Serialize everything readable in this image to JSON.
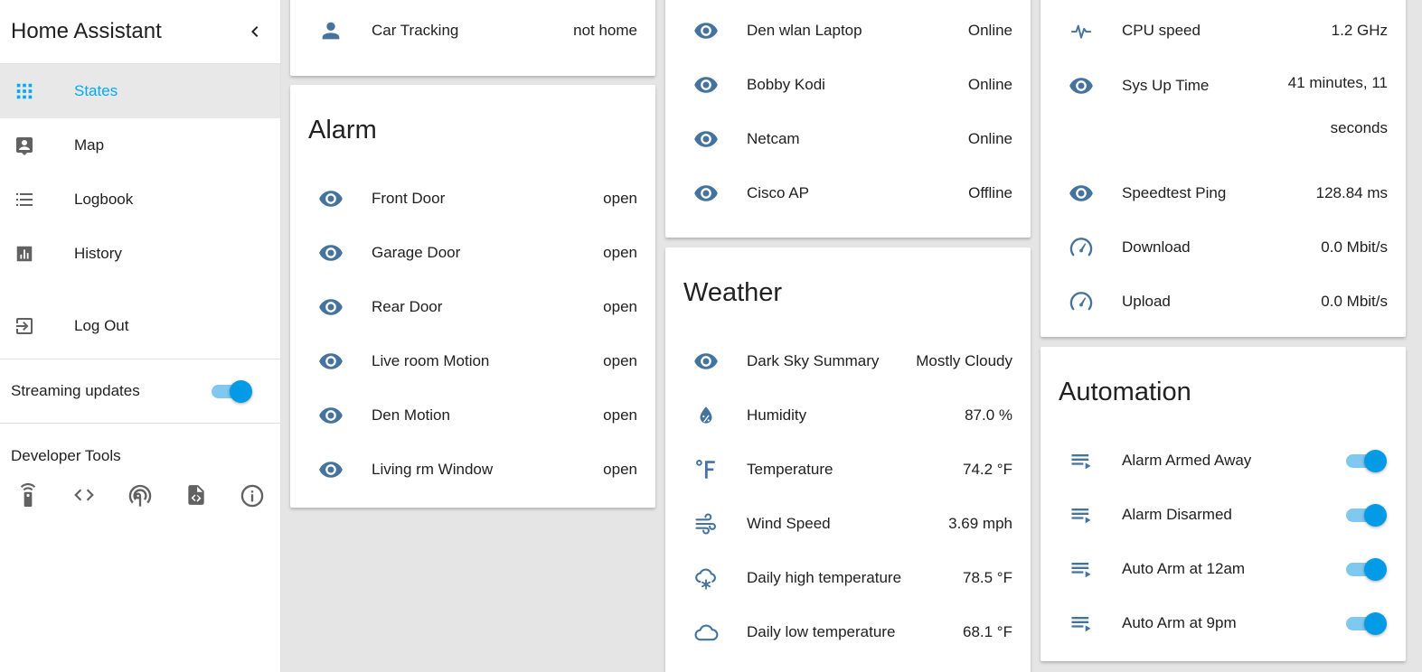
{
  "sidebar": {
    "title": "Home Assistant",
    "nav": [
      {
        "label": "States",
        "icon": "grid-icon",
        "active": true
      },
      {
        "label": "Map",
        "icon": "account-box-icon"
      },
      {
        "label": "Logbook",
        "icon": "list-icon"
      },
      {
        "label": "History",
        "icon": "chart-icon"
      }
    ],
    "logout_label": "Log Out",
    "streaming_label": "Streaming updates",
    "streaming_on": true,
    "dev_tools_title": "Developer Tools",
    "dev_tools": [
      "remote-icon",
      "code-icon",
      "broadcast-icon",
      "file-code-icon",
      "info-icon"
    ]
  },
  "colors": {
    "accent": "#03a9f4",
    "icon": "#44739e",
    "toggle": "#039be5"
  },
  "col1": {
    "car": {
      "name": "Car Tracking",
      "state": "not home"
    },
    "alarm": {
      "title": "Alarm",
      "items": [
        {
          "name": "Front Door",
          "state": "open"
        },
        {
          "name": "Garage Door",
          "state": "open"
        },
        {
          "name": "Rear Door",
          "state": "open"
        },
        {
          "name": "Live room Motion",
          "state": "open"
        },
        {
          "name": "Den Motion",
          "state": "open"
        },
        {
          "name": "Living rm Window",
          "state": "open"
        }
      ]
    }
  },
  "col2": {
    "devices": [
      {
        "name": "Den wlan Laptop",
        "state": "Online"
      },
      {
        "name": "Bobby Kodi",
        "state": "Online"
      },
      {
        "name": "Netcam",
        "state": "Online"
      },
      {
        "name": "Cisco AP",
        "state": "Offline"
      }
    ],
    "weather": {
      "title": "Weather",
      "items": [
        {
          "name": "Dark Sky Summary",
          "state": "Mostly Cloudy",
          "icon": "eye-icon"
        },
        {
          "name": "Humidity",
          "state": "87.0 %",
          "icon": "water-percent-icon"
        },
        {
          "name": "Temperature",
          "state": "74.2 °F",
          "icon": "fahrenheit-icon"
        },
        {
          "name": "Wind Speed",
          "state": "3.69 mph",
          "icon": "wind-icon"
        },
        {
          "name": "Daily high temperature",
          "state": "78.5 °F",
          "icon": "snow-cloud-icon"
        },
        {
          "name": "Daily low temperature",
          "state": "68.1 °F",
          "icon": "cloud-icon"
        }
      ]
    }
  },
  "col3": {
    "system": [
      {
        "name": "CPU speed",
        "state": "1.2 GHz",
        "icon": "pulse-icon"
      },
      {
        "name": "Sys Up Time",
        "state": "41 minutes, 11 seconds",
        "icon": "eye-icon"
      },
      {
        "name": "Speedtest Ping",
        "state": "128.84 ms",
        "icon": "eye-icon"
      },
      {
        "name": "Download",
        "state": "0.0 Mbit/s",
        "icon": "speedometer-icon"
      },
      {
        "name": "Upload",
        "state": "0.0 Mbit/s",
        "icon": "speedometer-icon"
      }
    ],
    "automation": {
      "title": "Automation",
      "items": [
        {
          "name": "Alarm Armed Away",
          "on": true
        },
        {
          "name": "Alarm Disarmed",
          "on": true
        },
        {
          "name": "Auto Arm at 12am",
          "on": true
        },
        {
          "name": "Auto Arm at 9pm",
          "on": true
        }
      ]
    }
  }
}
